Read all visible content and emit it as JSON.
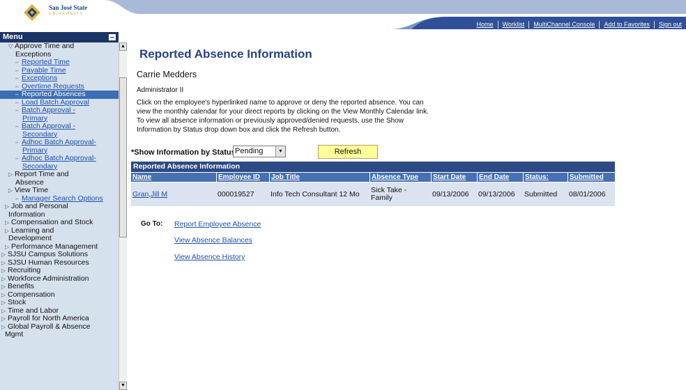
{
  "header": {
    "university_name": "San José State",
    "university_sub": "UNIVERSITY",
    "nav": [
      "Home",
      "Worklist",
      "MultiChannel Console",
      "Add to Favorites",
      "Sign out"
    ]
  },
  "menu": {
    "title": "Menu",
    "items": [
      {
        "text": "Approve Time and",
        "kind": "open",
        "indent": 1
      },
      {
        "text": "Exceptions",
        "kind": "text",
        "indent": 2
      },
      {
        "text": "Reported Time",
        "kind": "link",
        "indent": 2
      },
      {
        "text": "Payable Time",
        "kind": "link",
        "indent": 2
      },
      {
        "text": "Exceptions",
        "kind": "link",
        "indent": 2
      },
      {
        "text": "Overtime Requests",
        "kind": "link",
        "indent": 2
      },
      {
        "text": "Reported Absences",
        "kind": "selected",
        "indent": 2
      },
      {
        "text": "Load Batch Approval",
        "kind": "link",
        "indent": 2
      },
      {
        "text": "Batch Approval -",
        "kind": "link",
        "indent": 2
      },
      {
        "text": "Primary",
        "kind": "linkcont",
        "indent": 3
      },
      {
        "text": "Batch Approval -",
        "kind": "link",
        "indent": 2
      },
      {
        "text": "Secondary",
        "kind": "linkcont",
        "indent": 3
      },
      {
        "text": "Adhoc Batch Approval-",
        "kind": "link",
        "indent": 2
      },
      {
        "text": "Primary",
        "kind": "linkcont",
        "indent": 3
      },
      {
        "text": "Adhoc Batch Approval-",
        "kind": "link",
        "indent": 2
      },
      {
        "text": "Secondary",
        "kind": "linkcont",
        "indent": 3
      },
      {
        "text": "Report Time and",
        "kind": "closed",
        "indent": 1
      },
      {
        "text": "Absence",
        "kind": "text",
        "indent": 2
      },
      {
        "text": "View Time",
        "kind": "closed",
        "indent": 1
      },
      {
        "text": "Manager Search Options",
        "kind": "link",
        "indent": 2
      },
      {
        "text": "Job and Personal",
        "kind": "closed",
        "indent": 0.5
      },
      {
        "text": "Information",
        "kind": "text",
        "indent": 1
      },
      {
        "text": "Compensation and Stock",
        "kind": "closed",
        "indent": 0.5
      },
      {
        "text": "Learning and",
        "kind": "closed",
        "indent": 0.5
      },
      {
        "text": "Development",
        "kind": "text",
        "indent": 1
      },
      {
        "text": "Performance Management",
        "kind": "closed",
        "indent": 0.5
      },
      {
        "text": "SJSU Campus Solutions",
        "kind": "closed",
        "indent": 0
      },
      {
        "text": "SJSU Human Resources",
        "kind": "closed",
        "indent": 0
      },
      {
        "text": "Recruiting",
        "kind": "closed",
        "indent": 0
      },
      {
        "text": "Workforce Administration",
        "kind": "closed",
        "indent": 0
      },
      {
        "text": "Benefits",
        "kind": "closed",
        "indent": 0
      },
      {
        "text": "Compensation",
        "kind": "closed",
        "indent": 0
      },
      {
        "text": "Stock",
        "kind": "closed",
        "indent": 0
      },
      {
        "text": "Time and Labor",
        "kind": "closed",
        "indent": 0
      },
      {
        "text": "Payroll for North America",
        "kind": "closed",
        "indent": 0
      },
      {
        "text": "Global Payroll & Absence",
        "kind": "closed",
        "indent": 0
      },
      {
        "text": "Mgmt",
        "kind": "text",
        "indent": 0.5
      }
    ]
  },
  "page": {
    "title": "Reported Absence Information",
    "employee_name": "Carrie Medders",
    "employee_role": "Administrator II",
    "instructions": "Click on the employee's hyperlinked name to approve or deny the reported absence. You can view the monthly calendar for your direct reports by clicking on the View Monthly Calendar link. To view all absence information or previously approved/denied requests, use the Show Information by Status drop down box and click the Refresh button.",
    "status_label": "*Show Information by Status:",
    "status_value": "Pending",
    "refresh_label": "Refresh"
  },
  "grid": {
    "title": "Reported Absence Information",
    "headers": [
      "Name",
      "Employee ID",
      "Job Title",
      "Absence Type",
      "Start Date",
      "End Date",
      "Status:",
      "Submitted"
    ],
    "rows": [
      [
        "Gran,Jill M",
        "000019527",
        "Info Tech Consultant 12 Mo",
        "Sick Take - Family",
        "09/13/2006",
        "09/13/2006",
        "Submitted",
        "08/01/2006"
      ]
    ]
  },
  "goto": {
    "label": "Go To:",
    "links": [
      "Report Employee Absence",
      "View Absence Balances",
      "View Absence History"
    ]
  },
  "colors": {
    "header_blue": "#2c4a84",
    "menu_bg": "#d6e1ee",
    "title_blue": "#26437f",
    "refresh_yellow": "#ffff99"
  }
}
